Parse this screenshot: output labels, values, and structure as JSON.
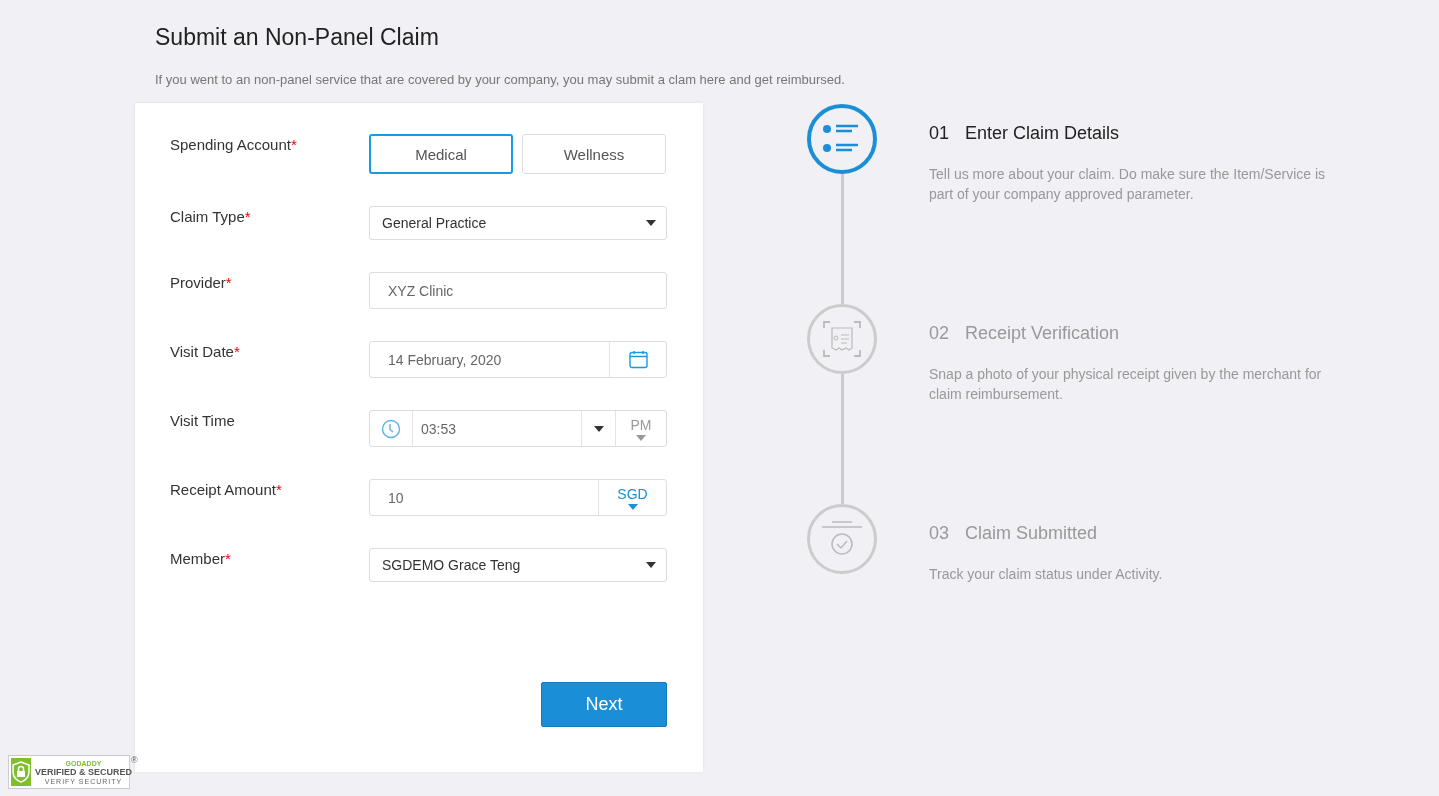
{
  "page": {
    "title": "Submit an Non-Panel Claim",
    "subtitle": "If you went to an non-panel service that are covered by your company, you may submit a clam here and get reimbursed."
  },
  "form": {
    "fields": [
      {
        "kind": "toggle",
        "label": "Spending Account",
        "required_mark": "*",
        "options": [
          {
            "label": "Medical",
            "selected": true
          },
          {
            "label": "Wellness",
            "selected": false
          }
        ]
      },
      {
        "kind": "select",
        "label": "Claim Type",
        "required_mark": "*",
        "value": "General Practice"
      },
      {
        "kind": "text",
        "label": "Provider",
        "required_mark": "*",
        "value": "XYZ Clinic"
      },
      {
        "kind": "date",
        "label": "Visit Date",
        "required_mark": "*",
        "value": "14 February, 2020"
      },
      {
        "kind": "time",
        "label": "Visit Time",
        "value": "03:53",
        "period": "PM"
      },
      {
        "kind": "amount",
        "label": "Receipt Amount",
        "required_mark": "*",
        "value": "10",
        "currency": "SGD"
      },
      {
        "kind": "select",
        "label": "Member",
        "required_mark": "*",
        "value": "SGDEMO Grace Teng"
      }
    ],
    "submit": "Next"
  },
  "steps": [
    {
      "number": "01",
      "title": "Enter Claim Details",
      "description": "Tell us more about your claim. Do make sure the Item/Service is part of your company approved parameter.",
      "active": true
    },
    {
      "number": "02",
      "title": "Receipt Verification",
      "description": "Snap a photo of your physical receipt given by the merchant for claim reimbursement.",
      "active": false
    },
    {
      "number": "03",
      "title": "Claim Submitted",
      "description": "Track your claim status under Activity.",
      "active": false
    }
  ],
  "seal": {
    "brand": "GODADDY",
    "title": "VERIFIED & SECURED",
    "link": "VERIFY SECURITY",
    "mark": "®"
  }
}
